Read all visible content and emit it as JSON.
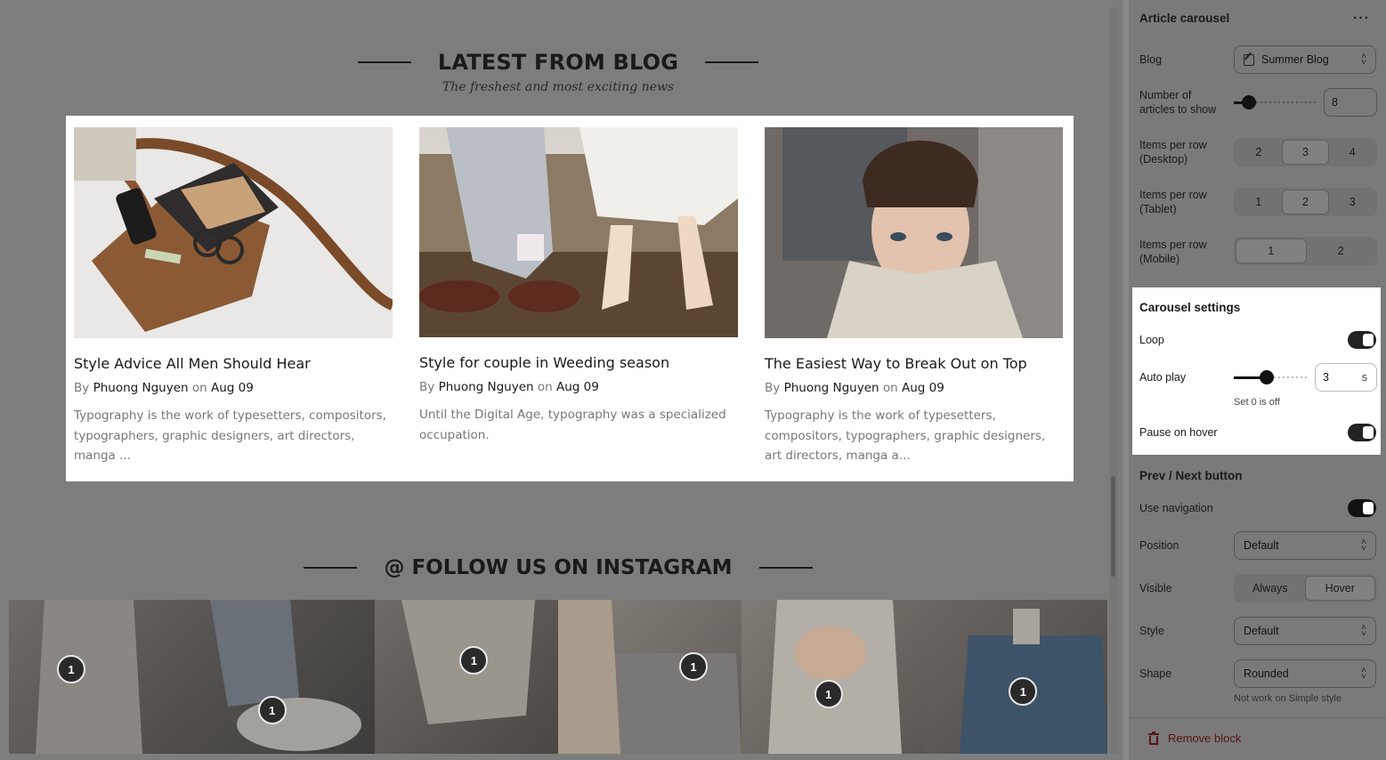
{
  "blog_section": {
    "title": "LATEST FROM BLOG",
    "subtitle": "The freshest and most exciting news",
    "articles": [
      {
        "title": "Style Advice All Men Should Hear",
        "by": "By",
        "author": "Phuong Nguyen",
        "on": "on",
        "date": "Aug 09",
        "excerpt": "  Typography is the work of typesetters, compositors, typographers, graphic designers, art directors, manga ..."
      },
      {
        "title": "Style for couple in Weeding season",
        "by": "By",
        "author": "Phuong Nguyen",
        "on": "on",
        "date": "Aug 09",
        "excerpt": "Until the Digital Age, typography was a specialized occupation."
      },
      {
        "title": "The Easiest Way to Break Out on Top",
        "by": "By",
        "author": "Phuong Nguyen",
        "on": "on",
        "date": "Aug 09",
        "excerpt": "Typography is the work of typesetters, compositors, typographers, graphic designers, art directors, manga a..."
      }
    ]
  },
  "instagram_section": {
    "title": "@ FOLLOW US ON INSTAGRAM",
    "badges": [
      "1",
      "1",
      "1",
      "1",
      "1",
      "1"
    ]
  },
  "sidebar": {
    "block_title": "Article carousel",
    "more_icon": "more-horizontal-icon",
    "blog": {
      "label": "Blog",
      "value": "Summer Blog",
      "icon": "edit-document-icon"
    },
    "articles_count": {
      "label": "Number of articles to show",
      "value": "8",
      "level": 0.18
    },
    "items_desktop": {
      "label": "Items per row (Desktop)",
      "options": [
        "2",
        "3",
        "4"
      ],
      "selected": "3"
    },
    "items_tablet": {
      "label": "Items per row (Tablet)",
      "options": [
        "1",
        "2",
        "3"
      ],
      "selected": "2"
    },
    "items_mobile": {
      "label": "Items per row (Mobile)",
      "options": [
        "1",
        "2"
      ],
      "selected": "1"
    },
    "carousel": {
      "heading": "Carousel settings",
      "loop": {
        "label": "Loop",
        "on": true
      },
      "autoplay": {
        "label": "Auto play",
        "value": "3",
        "unit": "s",
        "help": "Set 0 is off",
        "level": 0.45
      },
      "pause_hover": {
        "label": "Pause on hover",
        "on": true
      }
    },
    "prev_next": {
      "heading": "Prev / Next button",
      "use_navigation": {
        "label": "Use navigation",
        "on": true
      },
      "position": {
        "label": "Position",
        "value": "Default"
      },
      "visible": {
        "label": "Visible",
        "options": [
          "Always",
          "Hover"
        ],
        "selected": "Hover"
      },
      "style": {
        "label": "Style",
        "value": "Default"
      },
      "shape": {
        "label": "Shape",
        "value": "Rounded",
        "help": "Not work on Simple style"
      }
    },
    "remove_label": "Remove block",
    "remove_icon": "trash-icon"
  },
  "colors": {
    "remove": "#7a1c1c",
    "overlay": "#7d7d7d"
  }
}
